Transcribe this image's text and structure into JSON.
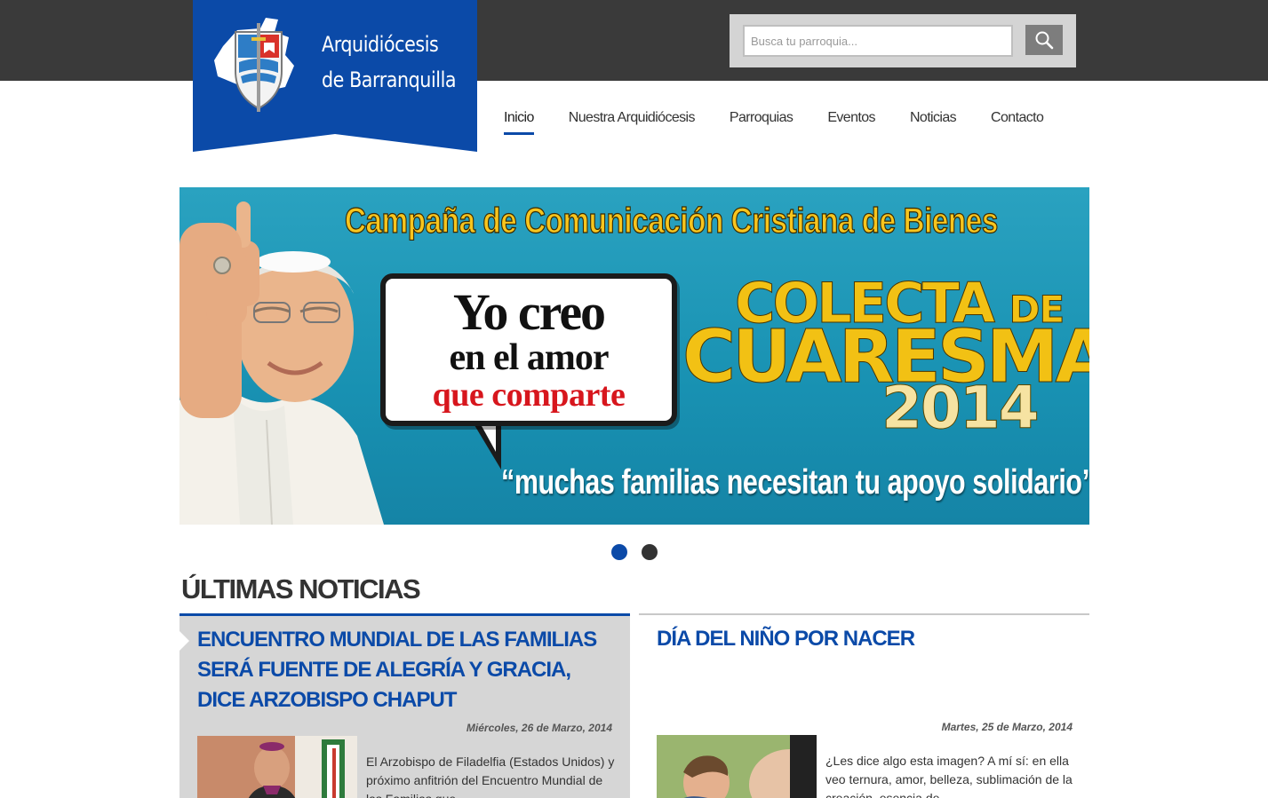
{
  "header": {
    "logo_line1": "Arquidiócesis",
    "logo_line2": "de Barranquilla",
    "search": {
      "placeholder": "Busca tu parroquia..."
    }
  },
  "nav": {
    "items": [
      {
        "label": "Inicio",
        "active": true
      },
      {
        "label": "Nuestra Arquidiócesis",
        "active": false
      },
      {
        "label": "Parroquias",
        "active": false
      },
      {
        "label": "Eventos",
        "active": false
      },
      {
        "label": "Noticias",
        "active": false
      },
      {
        "label": "Contacto",
        "active": false
      }
    ]
  },
  "banner": {
    "title": "Campaña de Comunicación Cristiana de Bienes",
    "bubble_line1": "Yo creo",
    "bubble_line2": "en el amor",
    "bubble_line3": "que comparte",
    "colecta_word": "COLECTA",
    "colecta_de": "DE",
    "cuaresma": "CUARESMA",
    "year": "2014",
    "quote": "“muchas familias necesitan tu apoyo solidario”"
  },
  "slider": {
    "total": 2,
    "active_index": 0
  },
  "news": {
    "section_title": "ÚLTIMAS NOTICIAS",
    "items": [
      {
        "title": "ENCUENTRO MUNDIAL DE LAS FAMILIAS SERÁ FUENTE DE ALEGRÍA Y GRACIA, DICE ARZOBISPO CHAPUT",
        "date": "Miércoles, 26 de Marzo, 2014",
        "excerpt": " El Arzobispo de Filadelfia (Estados Unidos) y próximo anfitrión del Encuentro Mundial de las Familias que"
      },
      {
        "title": "DÍA DEL NIÑO POR NACER",
        "date": "Martes, 25 de Marzo, 2014",
        "excerpt": "¿Les dice algo esta imagen? A mí sí: en ella veo ternura, amor, belleza, sublimación de la creación, esencia de"
      }
    ]
  },
  "colors": {
    "brand_blue": "#0b4aa8",
    "topbar": "#3a3a3a",
    "banner_teal": "#1f96b6",
    "banner_yellow": "#f2c114",
    "card_gray": "#d6d6d6"
  },
  "icons": {
    "search": "search-icon",
    "logo": "archdiocese-crest-icon"
  }
}
